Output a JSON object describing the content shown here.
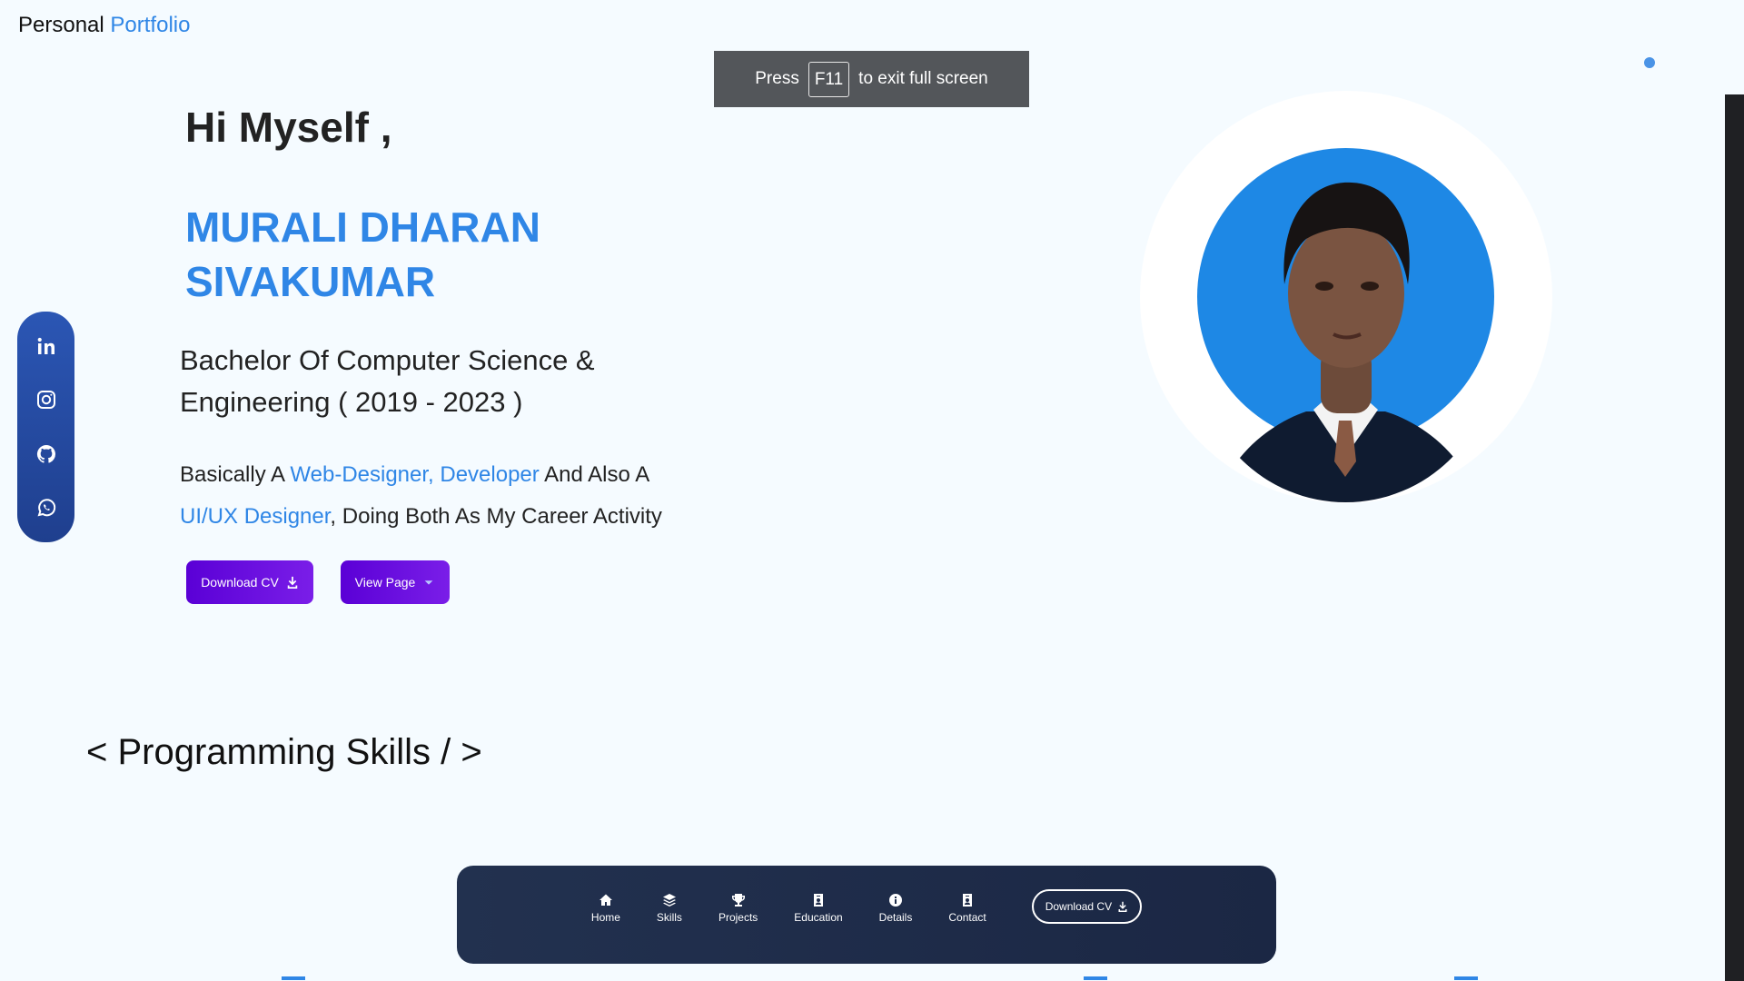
{
  "brand": {
    "primary": "Personal",
    "accent": "Portfolio"
  },
  "fullscreen_toast": {
    "pre": "Press",
    "key": "F11",
    "post": "to exit full screen"
  },
  "hero": {
    "greeting": "Hi Myself ,",
    "name_line1": "MURALI DHARAN",
    "name_line2": "SIVAKUMAR",
    "degree_line1": "Bachelor Of Computer Science &",
    "degree_line2": "Engineering ( 2019 - 2023 )",
    "summary": {
      "p1": "Basically A ",
      "h1": "Web-Designer, Developer",
      "p2": " And Also A ",
      "h2a": "UI/UX",
      "h2b": "Designer",
      "p3": ", Doing Both As My Career Activity"
    },
    "buttons": {
      "download_cv": "Download CV",
      "view_page": "View Page"
    }
  },
  "social": {
    "icons": [
      "linkedin-icon",
      "instagram-icon",
      "github-icon",
      "whatsapp-icon"
    ]
  },
  "sections": {
    "skills_title": "< Programming Skills / >"
  },
  "bottom_nav": {
    "items": [
      "Home",
      "Skills",
      "Projects",
      "Education",
      "Details",
      "Contact"
    ],
    "cv_button": "Download CV"
  },
  "colors": {
    "accent": "#2f86e6",
    "button_gradient": [
      "#5a00d6",
      "#7a1ee8"
    ],
    "nav_bg": "#22314f",
    "social_bg": "#2b56b4",
    "photo_bg": "#1e88e5"
  }
}
